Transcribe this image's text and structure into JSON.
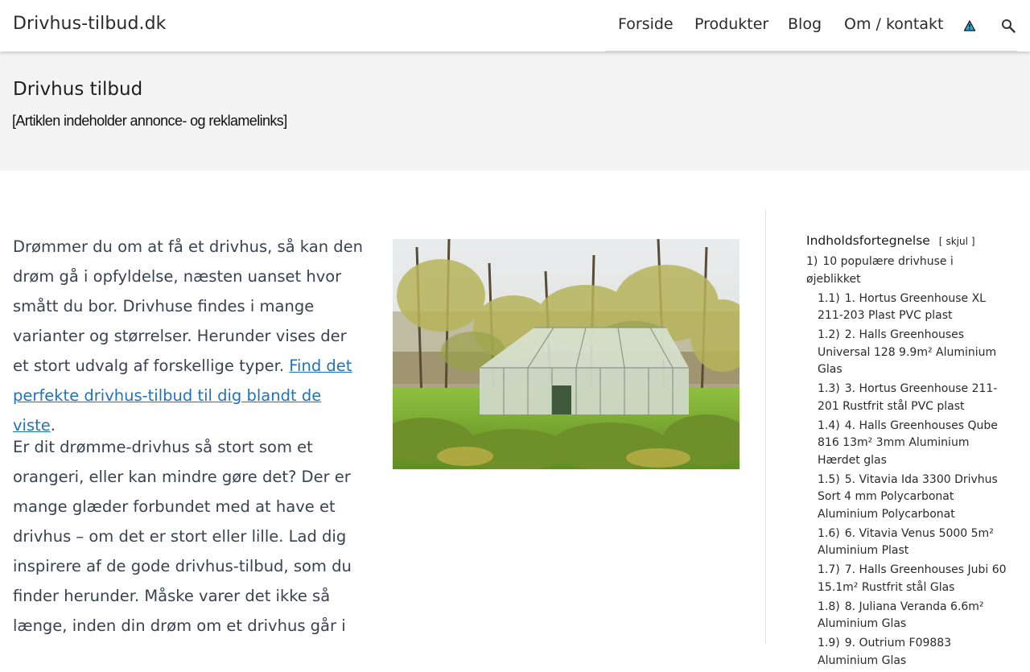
{
  "header": {
    "site_title": "Drivhus-tilbud.dk",
    "nav": [
      {
        "label": "Forside"
      },
      {
        "label": "Produkter"
      },
      {
        "label": "Blog"
      },
      {
        "label": "Om / kontakt"
      }
    ],
    "warning_icon": "warning-triangle-icon",
    "search_icon": "search-icon"
  },
  "title_band": {
    "page_title": "Drivhus tilbud",
    "ad_notice": "[Artiklen indeholder annonce- og reklamelinks]"
  },
  "content": {
    "intro": "Drømmer du om at få et drivhus, så kan den drøm gå i opfyldelse, næsten uanset hvor smått du bor. Drivhuse findes i mange varianter og størrelser. Herunder vises der et stort udvalg af forskellige typer. ",
    "intro_link": "Find det perfekte drivhus-tilbud til dig blandt de viste",
    "intro_end": ".",
    "second": "Er dit drømme-drivhus så stort som et orangeri, eller kan mindre gøre det? Der er mange glæder forbundet med at have et drivhus – om det er stort eller lille. Lad dig inspirere af de gode drivhus-tilbud, som du finder herunder. Måske varer det ikke så længe, inden din drøm om et drivhus går i",
    "image_subject": "greenhouse-photo"
  },
  "toc": {
    "title": "Indholdsfortegnelse",
    "toggle_open": "[",
    "toggle_label": "skjul",
    "toggle_close": "]",
    "items": [
      {
        "num": "1)",
        "label": "10 populære drivhuse i øjeblikket",
        "level": "top"
      },
      {
        "num": "1.1)",
        "label": "1. Hortus Greenhouse XL 211-203 Plast PVC plast",
        "level": "sub"
      },
      {
        "num": "1.2)",
        "label": "2. Halls Greenhouses Universal 128 9.9m² Aluminium Glas",
        "level": "sub"
      },
      {
        "num": "1.3)",
        "label": "3. Hortus Greenhouse 211-201 Rustfrit stål PVC plast",
        "level": "sub"
      },
      {
        "num": "1.4)",
        "label": "4. Halls Greenhouses Qube 816 13m² 3mm Aluminium Hærdet glas",
        "level": "sub"
      },
      {
        "num": "1.5)",
        "label": "5. Vitavia Ida 3300 Drivhus Sort 4 mm Polycarbonat Aluminium Polycarbonat",
        "level": "sub"
      },
      {
        "num": "1.6)",
        "label": "6. Vitavia Venus 5000 5m² Aluminium Plast",
        "level": "sub"
      },
      {
        "num": "1.7)",
        "label": "7. Halls Greenhouses Jubi 60 15.1m² Rustfrit stål Glas",
        "level": "sub"
      },
      {
        "num": "1.8)",
        "label": "8. Juliana Veranda 6.6m² Aluminium Glas",
        "level": "sub"
      },
      {
        "num": "1.9)",
        "label": "9. Outrium F09883 Aluminium Glas",
        "level": "sub"
      }
    ]
  }
}
